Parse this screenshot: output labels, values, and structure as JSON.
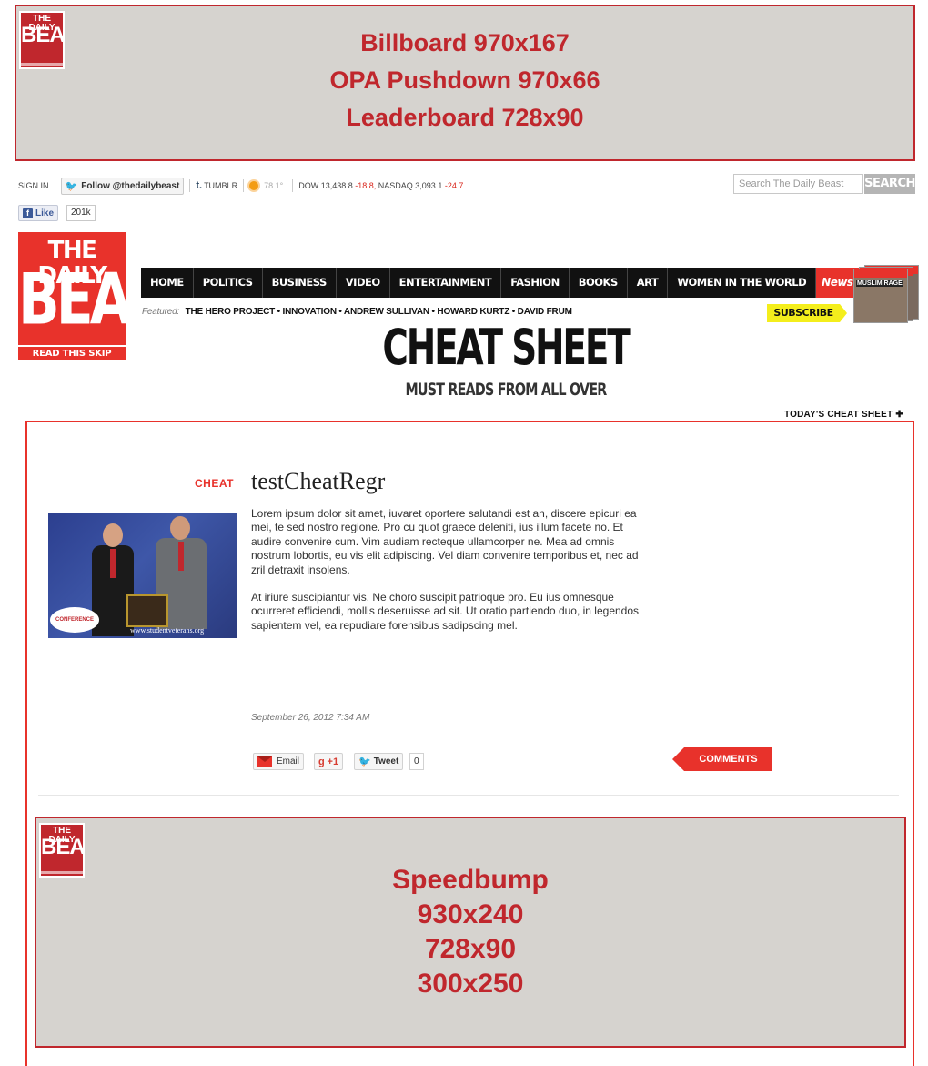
{
  "ads": {
    "top": {
      "lines": [
        "Billboard 970x167",
        "OPA Pushdown 970x66",
        "Leaderboard 728x90"
      ]
    },
    "speedbump": {
      "lines": [
        "Speedbump",
        "930x240",
        "728x90",
        "300x250"
      ]
    }
  },
  "brand": {
    "mini_line1": "THE DAILY",
    "mini_line2": "BEAST",
    "line1": "THE DAILY",
    "line2": "BEAST",
    "tagline": "READ THIS SKIP THAT"
  },
  "utility": {
    "sign_in": "SIGN IN",
    "follow": "Follow @thedailybeast",
    "tumblr_mark": "t.",
    "tumblr": "TUMBLR",
    "temp": "78.1°",
    "dow": "DOW 13,438.8",
    "dow_change": "-18.8,",
    "nasdaq": "NASDAQ 3,093.1",
    "nasdaq_change": "-24.7",
    "like": "Like",
    "like_count": "201k"
  },
  "search": {
    "placeholder": "Search The Daily Beast",
    "button": "SEARCH"
  },
  "nav": {
    "items": [
      "HOME",
      "POLITICS",
      "BUSINESS",
      "VIDEO",
      "ENTERTAINMENT",
      "FASHION",
      "BOOKS",
      "ART",
      "WOMEN IN THE WORLD"
    ],
    "newsweek": "Newsweek",
    "magazine_cover": "MUSLIM RAGE"
  },
  "featured": {
    "label": "Featured:",
    "links": "THE HERO PROJECT • INNOVATION • ANDREW SULLIVAN • HOWARD KURTZ • DAVID FRUM"
  },
  "subscribe": "SUBSCRIBE",
  "page": {
    "title": "CHEAT SHEET",
    "subtitle": "MUST READS FROM ALL OVER",
    "todays_link": "TODAY'S CHEAT SHEET ✚"
  },
  "article": {
    "tag": "CHEAT",
    "headline": "testCheatRegr",
    "paragraphs": [
      "Lorem ipsum dolor sit amet, iuvaret oportere salutandi est an, discere epicuri ea mei, te sed nostro regione. Pro cu quot graece deleniti, ius illum facete no. Et audire convenire cum. Vim audiam recteque ullamcorper ne. Mea ad omnis nostrum lobortis, eu vis elit adipiscing. Vel diam convenire temporibus et, nec ad zril detraxit insolens.",
      "At iriure suscipiantur vis. Ne choro suscipit patrioque pro. Eu ius omnesque ocurreret efficiendi, mollis deseruisse ad sit. Ut oratio partiendo duo, in legendos sapientem vel, ea repudiare forensibus sadipscing mel."
    ],
    "date": "September 26, 2012 7:34 AM",
    "photo_watermark": "www.studentveterans.org",
    "photo_badge": "CONFERENCE"
  },
  "share": {
    "email": "Email",
    "gplus": "+1",
    "gplus_mark": "g",
    "tweet": "Tweet",
    "tweet_count": "0",
    "comments": "COMMENTS"
  }
}
